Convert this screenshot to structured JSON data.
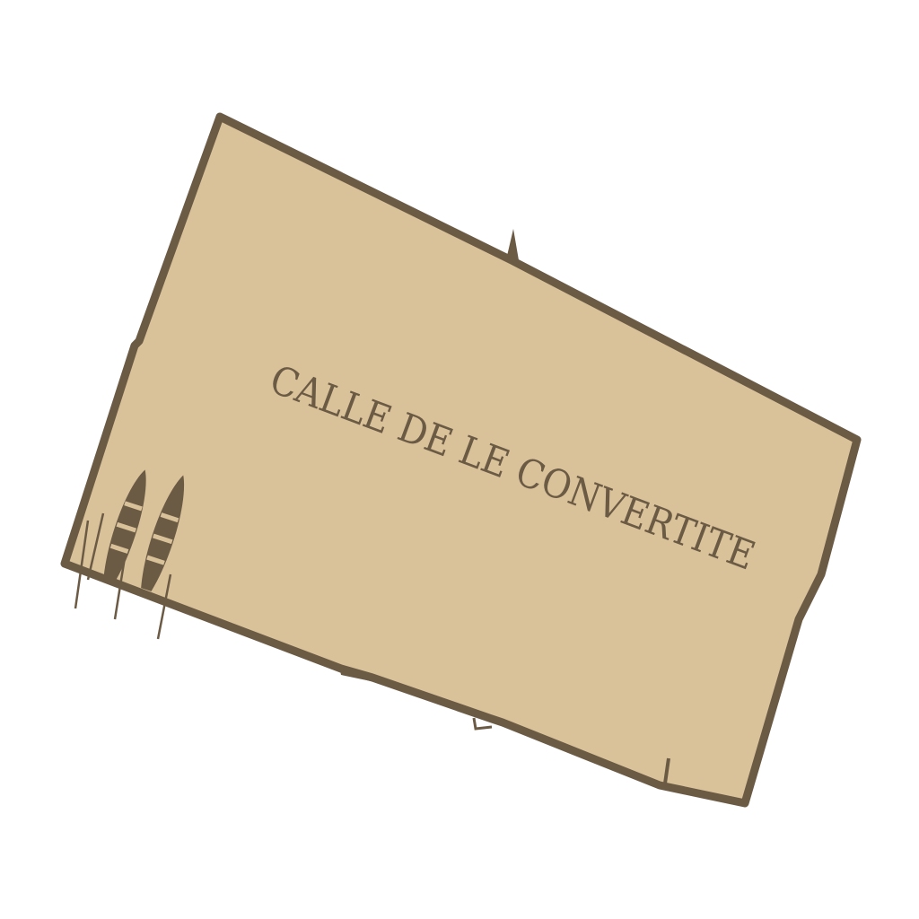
{
  "map": {
    "street_name": "CALLE DE LE CONVERTITE",
    "colors": {
      "parcel_fill": "#d9c29a",
      "parcel_outline": "#6b5a44",
      "boat_fill": "#6b5a44",
      "boat_stripe": "#d9c29a",
      "background": "#ffffff"
    },
    "features": {
      "moored_boats": 2
    }
  }
}
